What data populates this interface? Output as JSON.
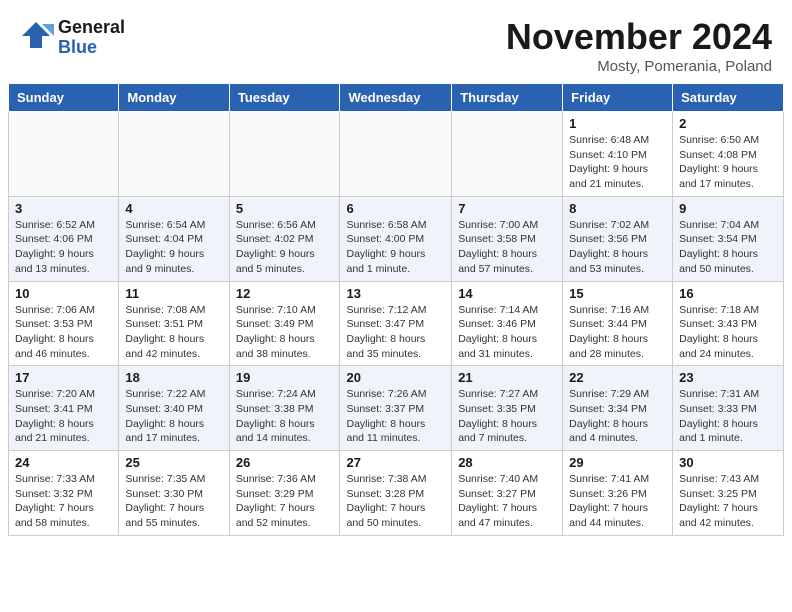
{
  "header": {
    "logo_line1": "General",
    "logo_line2": "Blue",
    "month_title": "November 2024",
    "location": "Mosty, Pomerania, Poland"
  },
  "columns": [
    "Sunday",
    "Monday",
    "Tuesday",
    "Wednesday",
    "Thursday",
    "Friday",
    "Saturday"
  ],
  "weeks": [
    [
      {
        "day": "",
        "info": ""
      },
      {
        "day": "",
        "info": ""
      },
      {
        "day": "",
        "info": ""
      },
      {
        "day": "",
        "info": ""
      },
      {
        "day": "",
        "info": ""
      },
      {
        "day": "1",
        "info": "Sunrise: 6:48 AM\nSunset: 4:10 PM\nDaylight: 9 hours and 21 minutes."
      },
      {
        "day": "2",
        "info": "Sunrise: 6:50 AM\nSunset: 4:08 PM\nDaylight: 9 hours and 17 minutes."
      }
    ],
    [
      {
        "day": "3",
        "info": "Sunrise: 6:52 AM\nSunset: 4:06 PM\nDaylight: 9 hours and 13 minutes."
      },
      {
        "day": "4",
        "info": "Sunrise: 6:54 AM\nSunset: 4:04 PM\nDaylight: 9 hours and 9 minutes."
      },
      {
        "day": "5",
        "info": "Sunrise: 6:56 AM\nSunset: 4:02 PM\nDaylight: 9 hours and 5 minutes."
      },
      {
        "day": "6",
        "info": "Sunrise: 6:58 AM\nSunset: 4:00 PM\nDaylight: 9 hours and 1 minute."
      },
      {
        "day": "7",
        "info": "Sunrise: 7:00 AM\nSunset: 3:58 PM\nDaylight: 8 hours and 57 minutes."
      },
      {
        "day": "8",
        "info": "Sunrise: 7:02 AM\nSunset: 3:56 PM\nDaylight: 8 hours and 53 minutes."
      },
      {
        "day": "9",
        "info": "Sunrise: 7:04 AM\nSunset: 3:54 PM\nDaylight: 8 hours and 50 minutes."
      }
    ],
    [
      {
        "day": "10",
        "info": "Sunrise: 7:06 AM\nSunset: 3:53 PM\nDaylight: 8 hours and 46 minutes."
      },
      {
        "day": "11",
        "info": "Sunrise: 7:08 AM\nSunset: 3:51 PM\nDaylight: 8 hours and 42 minutes."
      },
      {
        "day": "12",
        "info": "Sunrise: 7:10 AM\nSunset: 3:49 PM\nDaylight: 8 hours and 38 minutes."
      },
      {
        "day": "13",
        "info": "Sunrise: 7:12 AM\nSunset: 3:47 PM\nDaylight: 8 hours and 35 minutes."
      },
      {
        "day": "14",
        "info": "Sunrise: 7:14 AM\nSunset: 3:46 PM\nDaylight: 8 hours and 31 minutes."
      },
      {
        "day": "15",
        "info": "Sunrise: 7:16 AM\nSunset: 3:44 PM\nDaylight: 8 hours and 28 minutes."
      },
      {
        "day": "16",
        "info": "Sunrise: 7:18 AM\nSunset: 3:43 PM\nDaylight: 8 hours and 24 minutes."
      }
    ],
    [
      {
        "day": "17",
        "info": "Sunrise: 7:20 AM\nSunset: 3:41 PM\nDaylight: 8 hours and 21 minutes."
      },
      {
        "day": "18",
        "info": "Sunrise: 7:22 AM\nSunset: 3:40 PM\nDaylight: 8 hours and 17 minutes."
      },
      {
        "day": "19",
        "info": "Sunrise: 7:24 AM\nSunset: 3:38 PM\nDaylight: 8 hours and 14 minutes."
      },
      {
        "day": "20",
        "info": "Sunrise: 7:26 AM\nSunset: 3:37 PM\nDaylight: 8 hours and 11 minutes."
      },
      {
        "day": "21",
        "info": "Sunrise: 7:27 AM\nSunset: 3:35 PM\nDaylight: 8 hours and 7 minutes."
      },
      {
        "day": "22",
        "info": "Sunrise: 7:29 AM\nSunset: 3:34 PM\nDaylight: 8 hours and 4 minutes."
      },
      {
        "day": "23",
        "info": "Sunrise: 7:31 AM\nSunset: 3:33 PM\nDaylight: 8 hours and 1 minute."
      }
    ],
    [
      {
        "day": "24",
        "info": "Sunrise: 7:33 AM\nSunset: 3:32 PM\nDaylight: 7 hours and 58 minutes."
      },
      {
        "day": "25",
        "info": "Sunrise: 7:35 AM\nSunset: 3:30 PM\nDaylight: 7 hours and 55 minutes."
      },
      {
        "day": "26",
        "info": "Sunrise: 7:36 AM\nSunset: 3:29 PM\nDaylight: 7 hours and 52 minutes."
      },
      {
        "day": "27",
        "info": "Sunrise: 7:38 AM\nSunset: 3:28 PM\nDaylight: 7 hours and 50 minutes."
      },
      {
        "day": "28",
        "info": "Sunrise: 7:40 AM\nSunset: 3:27 PM\nDaylight: 7 hours and 47 minutes."
      },
      {
        "day": "29",
        "info": "Sunrise: 7:41 AM\nSunset: 3:26 PM\nDaylight: 7 hours and 44 minutes."
      },
      {
        "day": "30",
        "info": "Sunrise: 7:43 AM\nSunset: 3:25 PM\nDaylight: 7 hours and 42 minutes."
      }
    ]
  ]
}
